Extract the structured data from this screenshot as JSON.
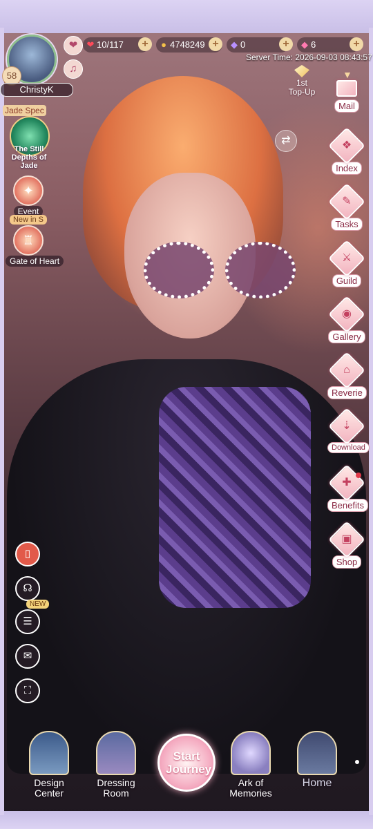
{
  "player": {
    "name": "ChristyK",
    "level": "58"
  },
  "resources": {
    "stamina": "10/117",
    "gold": "4748249",
    "diamonds": "0",
    "stars": "6"
  },
  "server_time": "Server Time: 2026-09-03 08:43:57",
  "left_events": {
    "jade_badge": "Jade Spec",
    "jade_title": "The Still Depths of Jade",
    "event_label": "Event",
    "new_badge": "New in S",
    "gate_label": "Gate of Heart"
  },
  "topup": {
    "line1": "1st",
    "line2": "Top-Up"
  },
  "right_menu": [
    {
      "label": "Mail",
      "icon": "mail-icon"
    },
    {
      "label": "Index",
      "icon": "index-icon"
    },
    {
      "label": "Tasks",
      "icon": "tasks-icon"
    },
    {
      "label": "Guild",
      "icon": "guild-icon"
    },
    {
      "label": "Gallery",
      "icon": "camera-icon"
    },
    {
      "label": "Reverie",
      "icon": "house-icon"
    },
    {
      "label": "Download",
      "icon": "download-icon"
    },
    {
      "label": "Benefits",
      "icon": "gift-icon"
    },
    {
      "label": "Shop",
      "icon": "bag-icon"
    }
  ],
  "tools": {
    "new_tag": "NEW"
  },
  "bottom_nav": {
    "design_center": "Design Center",
    "dressing_room": "Dressing Room",
    "start_journey": "Start Journey",
    "ark_of_memories": "Ark of Memories",
    "home": "Home"
  },
  "colors": {
    "frame": "#dcd3f3",
    "menu_accent": "#c3405f",
    "currency_plus": "#f1d9a8"
  }
}
